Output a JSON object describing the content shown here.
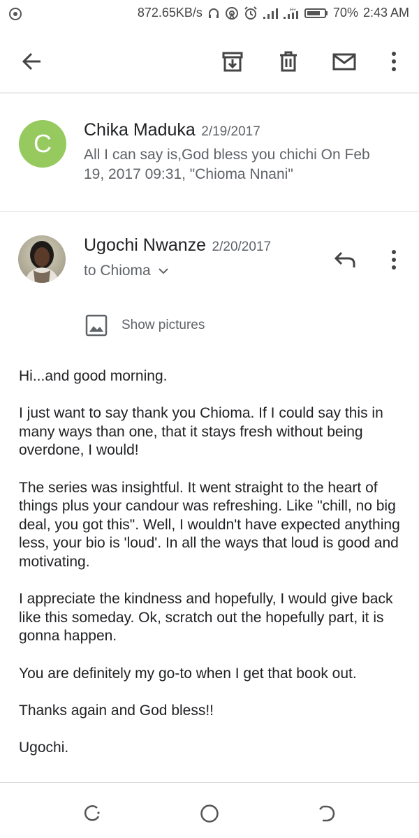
{
  "status_bar": {
    "network_speed": "872.65KB/s",
    "battery_percent": "70%",
    "time": "2:43 AM",
    "network_type": "H+"
  },
  "toolbar": {
    "back_icon": "arrow-back-icon",
    "archive_icon": "archive-icon",
    "delete_icon": "trash-icon",
    "mark_unread_icon": "mail-icon",
    "more_icon": "more-vert-icon"
  },
  "messages": [
    {
      "avatar_letter": "C",
      "avatar_color": "#96c95e",
      "sender": "Chika Maduka",
      "date": "2/19/2017",
      "snippet": "All I can say is,God bless you chichi On Feb 19, 2017 09:31, \"Chioma Nnani\""
    },
    {
      "sender": "Ugochi Nwanze",
      "date": "2/20/2017",
      "to_line": "to Chioma",
      "show_pictures_label": "Show pictures",
      "body": [
        "Hi...and good morning.",
        "I just want to say thank you Chioma. If I could say this in many ways than one, that it stays fresh without being overdone, I would!",
        "The series was insightful. It went straight to the heart of things plus your candour was refreshing. Like \"chill, no big deal, you got this\". Well, I wouldn't have expected anything less, your bio is 'loud'. In all the ways that loud is good and motivating.",
        "I appreciate the kindness and hopefully, I would give back like this someday. Ok, scratch out the hopefully part, it is gonna happen.",
        "You are definitely my go-to when I get that book out.",
        "Thanks again and God bless!!",
        "Ugochi."
      ]
    }
  ],
  "nav_bar": {
    "recents_icon": "recents-icon",
    "home_icon": "home-circle-icon",
    "back_icon": "nav-back-icon"
  }
}
